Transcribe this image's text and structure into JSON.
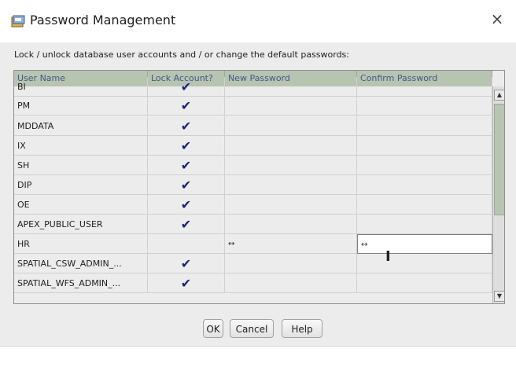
{
  "window": {
    "title": "Password Management",
    "close_label": "×"
  },
  "instruction": "Lock / unlock database user accounts and / or change the default passwords:",
  "table": {
    "columns": [
      "User Name",
      "Lock Account?",
      "New Password",
      "Confirm Password"
    ],
    "rows": [
      {
        "user": "BI",
        "lock": "✔",
        "new": "",
        "confirm": ""
      },
      {
        "user": "PM",
        "lock": "✔",
        "new": "",
        "confirm": ""
      },
      {
        "user": "MDDATA",
        "lock": "✔",
        "new": "",
        "confirm": ""
      },
      {
        "user": "IX",
        "lock": "✔",
        "new": "",
        "confirm": ""
      },
      {
        "user": "SH",
        "lock": "✔",
        "new": "",
        "confirm": ""
      },
      {
        "user": "DIP",
        "lock": "✔",
        "new": "",
        "confirm": ""
      },
      {
        "user": "OE",
        "lock": "✔",
        "new": "",
        "confirm": ""
      },
      {
        "user": "APEX_PUBLIC_USER",
        "lock": "✔",
        "new": "",
        "confirm": ""
      },
      {
        "user": "HR",
        "lock": "",
        "new": "↔",
        "confirm": "↔"
      },
      {
        "user": "SPATIAL_CSW_ADMIN_...",
        "lock": "✔",
        "new": "",
        "confirm": ""
      },
      {
        "user": "SPATIAL_WFS_ADMIN_...",
        "lock": "✔",
        "new": "",
        "confirm": ""
      }
    ]
  },
  "buttons": {
    "ok": "OK",
    "cancel": "Cancel",
    "help": "Help"
  }
}
